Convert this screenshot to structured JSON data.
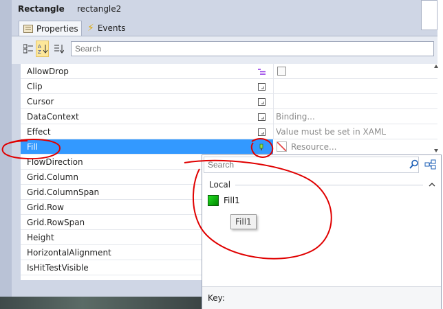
{
  "header": {
    "element_type": "Rectangle",
    "element_name": "rectangle2"
  },
  "tabs": [
    {
      "label": "Properties"
    },
    {
      "label": "Events"
    }
  ],
  "toolbar": {
    "buttons": [
      "categorize-view",
      "alphabetical-sort",
      "source-order-sort"
    ],
    "search": {
      "placeholder": "Search"
    }
  },
  "properties": [
    {
      "name": "AllowDrop",
      "value": ""
    },
    {
      "name": "Clip",
      "value": ""
    },
    {
      "name": "Cursor",
      "value": ""
    },
    {
      "name": "DataContext",
      "value": "Binding..."
    },
    {
      "name": "Effect",
      "value": "Value must be set in XAML"
    },
    {
      "name": "Fill",
      "value": "Resource..."
    },
    {
      "name": "FlowDirection",
      "value": ""
    },
    {
      "name": "Grid.Column",
      "value": ""
    },
    {
      "name": "Grid.ColumnSpan",
      "value": ""
    },
    {
      "name": "Grid.Row",
      "value": ""
    },
    {
      "name": "Grid.RowSpan",
      "value": ""
    },
    {
      "name": "Height",
      "value": ""
    },
    {
      "name": "HorizontalAlignment",
      "value": ""
    },
    {
      "name": "IsHitTestVisible",
      "value": ""
    }
  ],
  "resource_popup": {
    "search_placeholder": "Search",
    "group_label": "Local",
    "items": [
      {
        "label": "Fill1",
        "color": "#00b000"
      }
    ],
    "tooltip": "Fill1",
    "key_label": "Key:"
  },
  "colors": {
    "selection": "#3399ff",
    "annotation": "#e00000",
    "panel": "#cfd6e5"
  }
}
